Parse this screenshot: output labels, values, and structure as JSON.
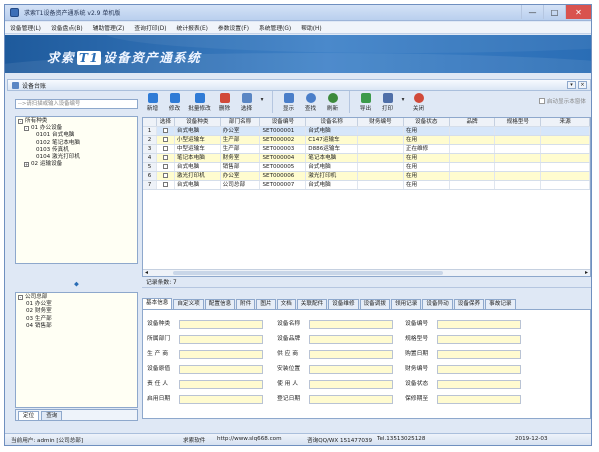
{
  "window": {
    "title": "求索T1设备资产通系统 v2.9 单机版",
    "min": "—",
    "max": "□",
    "close": "✕"
  },
  "menu": [
    "设备管理(L)",
    "设备盘点(B)",
    "辅助管理(Z)",
    "查询打印(D)",
    "统计报表(E)",
    "参数设置(F)",
    "系统管理(G)",
    "帮助(H)"
  ],
  "banner": {
    "brand_pre": "求索",
    "brand_num": "T1",
    "brand_post": "设备资产通系统"
  },
  "panel": {
    "title": "设备台账",
    "btn_pin": "▾",
    "btn_close": "×"
  },
  "search": {
    "placeholder": "-->请扫描或输入设备编号"
  },
  "tree_category": [
    {
      "text": "所有种类",
      "box": "-"
    },
    {
      "text": "01  办公设备",
      "box": "-"
    },
    {
      "text": "0101  台式电脑"
    },
    {
      "text": "0102  笔记本电脑"
    },
    {
      "text": "0103  传真机"
    },
    {
      "text": "0104  激光打印机"
    },
    {
      "text": "02  运输设备",
      "box": "+"
    }
  ],
  "splitter_icon": "⬥",
  "tree_dept": [
    {
      "text": "公司总部",
      "box": "-"
    },
    {
      "text": "01  办公室"
    },
    {
      "text": "02  财务室"
    },
    {
      "text": "03  生产部"
    },
    {
      "text": "04  销售部"
    }
  ],
  "left_tabs": [
    "定位",
    "查询"
  ],
  "toolbar": {
    "add": "新增",
    "edit": "修改",
    "batch_edit": "批量修改",
    "delete": "删除",
    "select": "选择",
    "dropdown": "▾",
    "show": "显示",
    "find": "查找",
    "refresh": "刷新",
    "export": "导出",
    "print": "打印",
    "close": "关闭",
    "auto_show": "启动显示本窗体"
  },
  "colors": {
    "add": "#2f7bd6",
    "edit": "#2f7bd6",
    "batch_edit": "#2f7bd6",
    "delete": "#d14a3a",
    "select": "#5a86c4",
    "show": "#4a7ec9",
    "find": "#4a7ec9",
    "refresh": "#3c8a3c",
    "export": "#3c9a4a",
    "print": "#4f6fa8",
    "close": "#d14a3a"
  },
  "table": {
    "headers": [
      "",
      "选择",
      "设备种类",
      "部门名称",
      "设备编号",
      "设备名称",
      "财务编号",
      "设备状态",
      "品牌",
      "规格型号",
      "来源"
    ],
    "rows": [
      [
        "1",
        "台式电脑",
        "办公室",
        "SET000001",
        "台式电脑",
        "",
        "在用"
      ],
      [
        "2",
        "小型运输车",
        "生产部",
        "SET000002",
        "C147运输车",
        "",
        "在用"
      ],
      [
        "3",
        "中型运输车",
        "生产部",
        "SET000003",
        "D886运输车",
        "",
        "正在维修"
      ],
      [
        "4",
        "笔记本电脑",
        "财务室",
        "SET000004",
        "笔记本电脑",
        "",
        "在用"
      ],
      [
        "5",
        "台式电脑",
        "销售部",
        "SET000005",
        "台式电脑",
        "",
        "在用"
      ],
      [
        "6",
        "激光打印机",
        "办公室",
        "SET000006",
        "激光打印机",
        "",
        "在用"
      ],
      [
        "7",
        "台式电脑",
        "公司总部",
        "SET000007",
        "台式电脑",
        "",
        "在用"
      ]
    ]
  },
  "scroll": {
    "left": "◂",
    "right": "▸"
  },
  "record_count": "记录条数: 7",
  "detail_tabs": [
    "基本信息",
    "自定义项",
    "配置信息",
    "附件",
    "图片",
    "文档",
    "关联配件",
    "设备维修",
    "设备调拨",
    "领用记录",
    "设备异动",
    "设备保养",
    "事故记录"
  ],
  "form_rows": [
    [
      "设备种类",
      "设备名称",
      "设备编号"
    ],
    [
      "所属部门",
      "设备品牌",
      "规格型号"
    ],
    [
      "生 产 商",
      "供 应 商",
      "购置日期"
    ],
    [
      "设备原值",
      "安装位置",
      "财务编号"
    ],
    [
      "责 任 人",
      "使 用 人",
      "设备状态"
    ],
    [
      "启用日期",
      "登记日期",
      "保修期至"
    ]
  ],
  "status": {
    "user": "当前用户: admin [公司总部]",
    "company": "求索软件",
    "url": "http://www.slq668.com",
    "qq": "咨询QQ/WX 151477039",
    "tel": "Tel.13513025128",
    "date": "2019-12-03"
  }
}
